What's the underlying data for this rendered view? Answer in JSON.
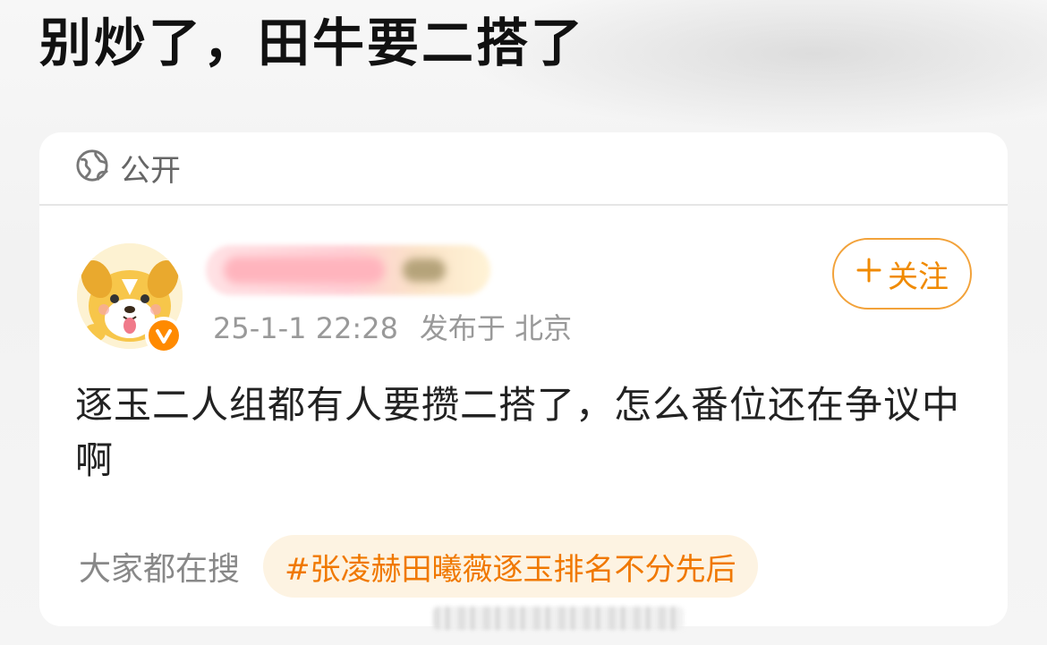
{
  "page": {
    "title": "别炒了，田牛要二搭了"
  },
  "post": {
    "visibility": "公开",
    "time": "25-1-1 22:28",
    "location": "发布于 北京",
    "follow_label": "关注",
    "text": "逐玉二人组都有人要攒二搭了，怎么番位还在争议中啊"
  },
  "search": {
    "label": "大家都在搜",
    "topic": "#张凌赫田曦薇逐玉排名不分先后"
  },
  "colors": {
    "accent": "#f08a00",
    "badge": "#ff8a00",
    "tag_bg": "#fdf3e2"
  },
  "icons": {
    "visibility": "globe-icon",
    "follow": "plus-icon",
    "verified": "verified-check-icon"
  }
}
